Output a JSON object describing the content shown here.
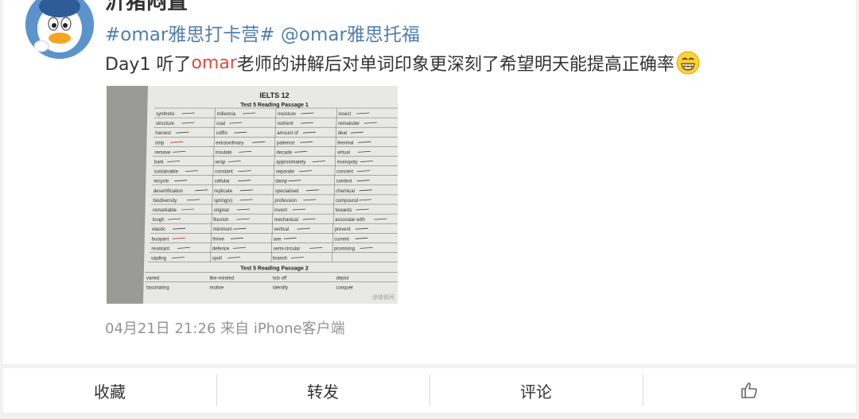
{
  "post": {
    "username": "沂猪闷置",
    "tags": {
      "tag1": "#omar雅思打卡营#",
      "mention": "@omar雅思",
      "after_mention": "托福"
    },
    "text": {
      "part1": "Day1 听了",
      "highlight": "omar",
      "part2": "老师的讲解后对单词印象更深刻了希望明天能提高正确率"
    },
    "meta": "04月21日 21:26  来自 iPhone客户端",
    "photo": {
      "sheet_title": "IELTS 12",
      "passage1": "Test 5   Reading Passage 1",
      "passage2": "Test 5   Reading Passage 2",
      "watermark": "@徐徐间",
      "rows1": [
        [
          "synthetic",
          "millennia",
          "moisture",
          "insect"
        ],
        [
          "structure",
          "coal",
          "nutrient",
          "remainder"
        ],
        [
          "harvest",
          "coffin",
          "amount of",
          "deal"
        ],
        [
          "strip",
          "extraordinary",
          "patience",
          "thermal"
        ],
        [
          "remove",
          "insulate",
          "decade",
          "virtual"
        ],
        [
          "bark",
          "wrap",
          "approximately",
          "monopoly"
        ],
        [
          "sustainable",
          "constant",
          "separate",
          "concern"
        ],
        [
          "recycle",
          "cellular",
          "damp",
          "content"
        ],
        [
          "desertification",
          "replicate",
          "specialised",
          "chemical"
        ],
        [
          "biodiversity",
          "spring(v)",
          "profession",
          "compound"
        ],
        [
          "remarkable",
          "original",
          "invent",
          "towards"
        ],
        [
          "tough",
          "flourish",
          "mechanical",
          "associate with"
        ],
        [
          "elastic",
          "minimum",
          "vertical",
          "prevent"
        ],
        [
          "buoyant",
          "thrive",
          "axe",
          "current"
        ],
        [
          "resistant",
          "defence",
          "semi-circular",
          "promising"
        ],
        [
          "sapling",
          "spoil",
          "branch",
          ""
        ]
      ],
      "rows2": [
        [
          "varied",
          "like-minded",
          "tick off",
          "depict"
        ],
        [
          "fascinating",
          "motive",
          "identify",
          "conquer"
        ]
      ]
    }
  },
  "actions": {
    "collect": "收藏",
    "repost": "转发",
    "comment": "评论"
  },
  "colors": {
    "link_blue": "#507daf",
    "highlight_red": "#e04b42",
    "meta_gray": "#939393"
  }
}
